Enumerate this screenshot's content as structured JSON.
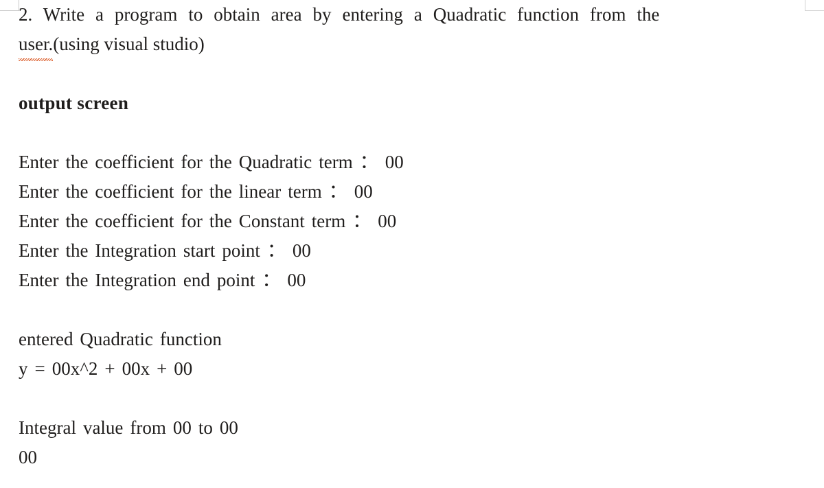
{
  "page": {
    "background_color": "#ffffff",
    "text_color": "#1f1d1c",
    "spellcheck_underline_color": "#d9541e",
    "margin_guide_color": "#c8c8c8"
  },
  "question": {
    "line1": "2. Write a program to obtain area by entering a Quadratic function from the",
    "line2_misspelled": "user.",
    "line2_rest": "(using visual studio)"
  },
  "section_heading": "output screen",
  "console": {
    "prompts": [
      "Enter the coefficient for the Quadratic term ： 00",
      "Enter the coefficient for the linear term ： 00",
      "Enter the coefficient for the Constant term ： 00",
      "Enter the Integration start point ： 00",
      "Enter the Integration end point ： 00"
    ],
    "function_label": "entered Quadratic function",
    "function_equation": "y = 00x^2 + 00x + 00",
    "integral_label": "Integral value from 00 to 00",
    "integral_value": "00"
  }
}
